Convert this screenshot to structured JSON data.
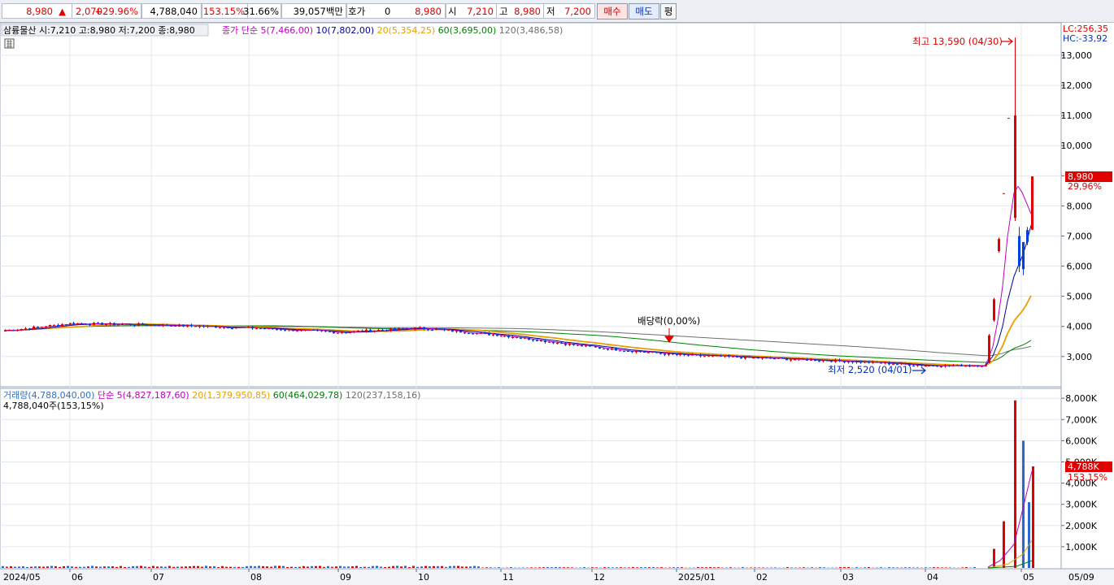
{
  "quote_bar": {
    "price": "8,980",
    "change": "2,070",
    "change_pct": "+29.96%",
    "volume": "4,788,040",
    "volume_ratio": "153.15%",
    "turnover": "31.66%",
    "amount": "39,057백만",
    "hoga_label": "호가",
    "hoga_value": "0",
    "hoga_price": "8,980",
    "open_label": "시",
    "open": "7,210",
    "high_label": "고",
    "high": "8,980",
    "low_label": "저",
    "low": "7,200",
    "buy_label": "매수",
    "sell_label": "매도",
    "eval_label": "평"
  },
  "price_panel": {
    "stock_info": "삼륭물산 시:7,210 고:8,980 저:7,200 종:8,980",
    "ma_legend": [
      {
        "label": "종가 단순 5(7,466,00)",
        "color": "#c000c0"
      },
      {
        "label": "10(7,802,00)",
        "color": "#0000a0"
      },
      {
        "label": "20(5,354,25)",
        "color": "#e8a000"
      },
      {
        "label": "60(3,695,00)",
        "color": "#008000"
      },
      {
        "label": "120(3,486,58)",
        "color": "#707070"
      }
    ],
    "lc_label": "LC:256,35",
    "hc_label": "HC:-33,92",
    "high_annotation": "최고 13,590 (04/30)",
    "low_annotation": "최저 2,520 (04/01)",
    "dividend_annotation": "배당락(0,00%)",
    "current_price_tag": "8,980",
    "current_pct_tag": "29,96%",
    "y_ticks": [
      "13,000",
      "12,000",
      "11,000",
      "10,000",
      "9,000",
      "8,000",
      "7,000",
      "6,000",
      "5,000",
      "4,000",
      "3,000"
    ]
  },
  "volume_panel": {
    "legend": [
      {
        "label": "거래량(4,788,040,00)",
        "color": "#3070c0"
      },
      {
        "label": "단순 5(4,827,187,60)",
        "color": "#c000c0"
      },
      {
        "label": "20(1,379,950,85)",
        "color": "#e8a000"
      },
      {
        "label": "60(464,029,78)",
        "color": "#008000"
      },
      {
        "label": "120(237,158,16)",
        "color": "#707070"
      }
    ],
    "volume_label": "4,788,040주(153,15%)",
    "current_tag": "4,788K",
    "current_pct_tag": "153,15%",
    "y_ticks": [
      "8,000K",
      "7,000K",
      "6,000K",
      "5,000K",
      "4,000K",
      "3,000K",
      "2,000K",
      "1,000K"
    ]
  },
  "x_axis": {
    "labels": [
      "2024/05",
      "06",
      "07",
      "08",
      "09",
      "10",
      "11",
      "12",
      "2025/01",
      "02",
      "03",
      "04",
      "05",
      "05/09"
    ]
  },
  "chart_data": [
    {
      "type": "candlestick",
      "title": "삼륭물산",
      "y_axis_unit": "KRW",
      "ylim": [
        2300,
        13800
      ],
      "x_range": [
        "2024/05",
        "2025/05/09"
      ],
      "price_series": [
        {
          "date": "2024/05",
          "close": 3850
        },
        {
          "date": "06",
          "close": 4100
        },
        {
          "date": "07",
          "close": 4050
        },
        {
          "date": "08",
          "close": 3950
        },
        {
          "date": "09",
          "close": 3800
        },
        {
          "date": "10",
          "close": 3950
        },
        {
          "date": "11",
          "close": 3700
        },
        {
          "date": "12",
          "close": 3300
        },
        {
          "date": "2025/01",
          "close": 3050
        },
        {
          "date": "02",
          "close": 2950
        },
        {
          "date": "03",
          "close": 2850
        },
        {
          "date": "04",
          "close": 2700
        },
        {
          "date": "04/22",
          "close": 3700
        },
        {
          "date": "04/25",
          "close": 6900
        },
        {
          "date": "04/30",
          "close": 11000,
          "high": 13590
        },
        {
          "date": "05/02",
          "close": 6800
        },
        {
          "date": "05/09",
          "open": 7210,
          "high": 8980,
          "low": 7200,
          "close": 8980
        }
      ],
      "annotations": [
        {
          "text": "최고 13,590 (04/30)",
          "value": 13590
        },
        {
          "text": "최저 2,520 (04/01)",
          "value": 2520
        },
        {
          "text": "배당락(0,00%)"
        }
      ]
    },
    {
      "type": "bar",
      "title": "거래량",
      "y_axis_unit": "K",
      "ylim": [
        0,
        8300
      ],
      "volume_series": [
        {
          "date": "04/25",
          "value": 900
        },
        {
          "date": "04/28",
          "value": 2200
        },
        {
          "date": "04/30",
          "value": 7900
        },
        {
          "date": "05/02",
          "value": 6000
        },
        {
          "date": "05/07",
          "value": 3100
        },
        {
          "date": "05/09",
          "value": 4788
        }
      ]
    }
  ]
}
